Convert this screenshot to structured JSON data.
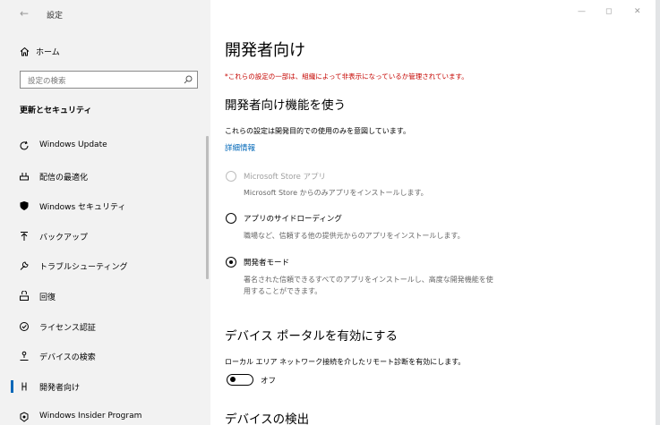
{
  "app": {
    "title": "設定"
  },
  "sidebar": {
    "home_label": "ホーム",
    "search_placeholder": "設定の検索",
    "section_title": "更新とセキュリティ",
    "items": [
      {
        "label": "Windows Update",
        "icon": "refresh-icon"
      },
      {
        "label": "配信の最適化",
        "icon": "delivery-optimization-icon"
      },
      {
        "label": "Windows セキュリティ",
        "icon": "shield-icon"
      },
      {
        "label": "バックアップ",
        "icon": "backup-arrow-icon"
      },
      {
        "label": "トラブルシューティング",
        "icon": "wrench-icon"
      },
      {
        "label": "回復",
        "icon": "recovery-icon"
      },
      {
        "label": "ライセンス認証",
        "icon": "check-circle-icon"
      },
      {
        "label": "デバイスの検索",
        "icon": "find-device-icon"
      },
      {
        "label": "開発者向け",
        "icon": "developer-icon",
        "selected": true
      },
      {
        "label": "Windows Insider Program",
        "icon": "insider-icon"
      }
    ]
  },
  "main": {
    "title": "開発者向け",
    "notice": "*これらの設定の一部は、組織によって非表示になっているか管理されています。",
    "dev_features": {
      "heading": "開発者向け機能を使う",
      "description": "これらの設定は開発目的での使用のみを意図しています。",
      "link": "詳細情報",
      "options": [
        {
          "label": "Microsoft Store アプリ",
          "desc": "Microsoft Store からのみアプリをインストールします。",
          "disabled": true,
          "checked": false
        },
        {
          "label": "アプリのサイドローディング",
          "desc": "職場など、信頼する他の提供元からのアプリをインストールします。",
          "disabled": false,
          "checked": false
        },
        {
          "label": "開発者モード",
          "desc_line1": "署名された信頼できるすべてのアプリをインストールし、高度な開発機能を使",
          "desc_line2": "用することができます。",
          "disabled": false,
          "checked": true
        }
      ]
    },
    "device_portal": {
      "heading": "デバイス ポータルを有効にする",
      "description": "ローカル エリア ネットワーク接続を介したリモート診断を有効にします。",
      "toggle_state": "オフ"
    },
    "device_discovery": {
      "heading": "デバイスの検出"
    }
  },
  "colors": {
    "accent": "#0067b8",
    "notice": "#c50500",
    "sidebar_bg": "#f2f2f2"
  }
}
